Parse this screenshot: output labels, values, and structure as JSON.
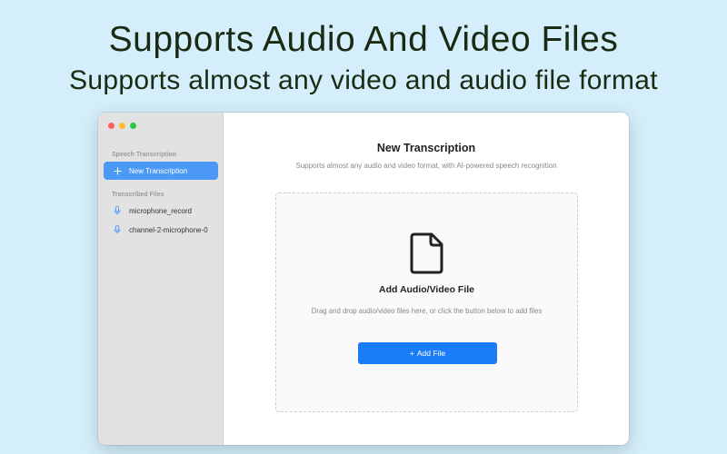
{
  "hero": {
    "title": "Supports Audio And Video Files",
    "subtitle": "Supports almost any video and audio file format"
  },
  "sidebar": {
    "section_transcription": "Speech Transcription",
    "new_transcription": "New Transcription",
    "section_files": "Transcribed Files",
    "files": [
      {
        "label": "microphone_record",
        "icon": "microphone-icon"
      },
      {
        "label": "channel-2-microphone-0",
        "icon": "microphone-icon"
      }
    ]
  },
  "main": {
    "title": "New Transcription",
    "subtitle": "Supports almost any audio and video format, with AI-powered speech recognition",
    "dropzone": {
      "icon": "document-icon",
      "title": "Add Audio/Video File",
      "hint": "Drag and drop audio/video files here, or click the button below to add files",
      "button_icon": "+",
      "button_label": "Add File"
    }
  },
  "colors": {
    "background": "#d4effb",
    "accent": "#1a7cf7",
    "sidebar_active": "#4c99f6",
    "sidebar_bg": "#e2e2e2"
  }
}
